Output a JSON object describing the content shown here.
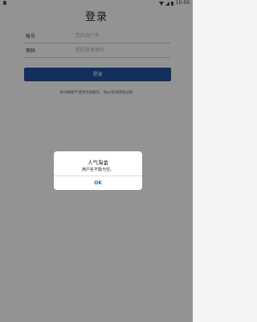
{
  "status_bar": {
    "time": "10:50",
    "icons": [
      "sim-icon",
      "wifi-icon",
      "signal-icon",
      "battery-icon"
    ]
  },
  "page": {
    "title": "登录"
  },
  "form": {
    "account": {
      "label": "帐号",
      "value": "",
      "placeholder": "您的用户名"
    },
    "password": {
      "label": "密码",
      "value": "",
      "placeholder": "您的登录密码"
    },
    "login_button_label": "登录",
    "notice": "移动端暂不提供注册服务，请pc登录网站注册"
  },
  "dialog": {
    "title": "人气淘金",
    "message": "用户名不能为空。",
    "ok_label": "OK"
  },
  "colors": {
    "primary_button": "#1f4f9b",
    "dialog_button_text": "#1a73a8",
    "overlay": "rgba(0,0,0,0.4)"
  }
}
